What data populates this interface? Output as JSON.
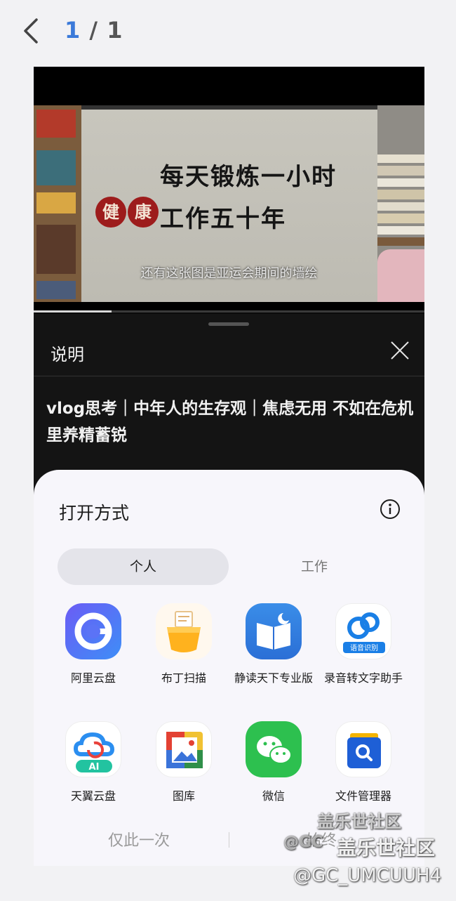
{
  "topbar": {
    "current_page": "1",
    "separator": " / ",
    "total_pages": "1"
  },
  "video": {
    "poster_line1": "每天锻炼一小时",
    "poster_seal_1": "健",
    "poster_seal_2": "康",
    "poster_line2": "工作五十年",
    "subtitle": "还有这张图是亚运会期间的墙绘",
    "progress": 0.2
  },
  "description": {
    "title": "说明",
    "text": "vlog思考｜中年人的生存观｜焦虑无用 不如在危机里养精蓄锐"
  },
  "open_with": {
    "title": "打开方式",
    "tabs": [
      "个人",
      "工作"
    ],
    "apps": [
      {
        "name": "阿里云盘",
        "icon": "aliyun-drive-icon"
      },
      {
        "name": "布丁扫描",
        "icon": "pudding-scan-icon"
      },
      {
        "name": "静读天下专业版",
        "icon": "moon-reader-icon"
      },
      {
        "name": "录音转文字助手",
        "icon": "recorder-transcribe-icon",
        "badge": "语音识别"
      },
      {
        "name": "天翼云盘",
        "icon": "tianyi-cloud-icon",
        "badge": "AI"
      },
      {
        "name": "图库",
        "icon": "gallery-icon"
      },
      {
        "name": "微信",
        "icon": "wechat-icon"
      },
      {
        "name": "文件管理器",
        "icon": "file-manager-icon"
      }
    ],
    "just_once": "仅此一次",
    "always": "始终"
  },
  "watermarks": {
    "line1": "盖乐世社区",
    "line2_prefix": "@GC",
    "line2": "盖乐世社区",
    "line3": "@GC_UMCUUH4"
  },
  "colors": {
    "accent": "#3b7ad9",
    "sheet_bg": "#f7f6fb",
    "panel_bg": "#141414"
  }
}
